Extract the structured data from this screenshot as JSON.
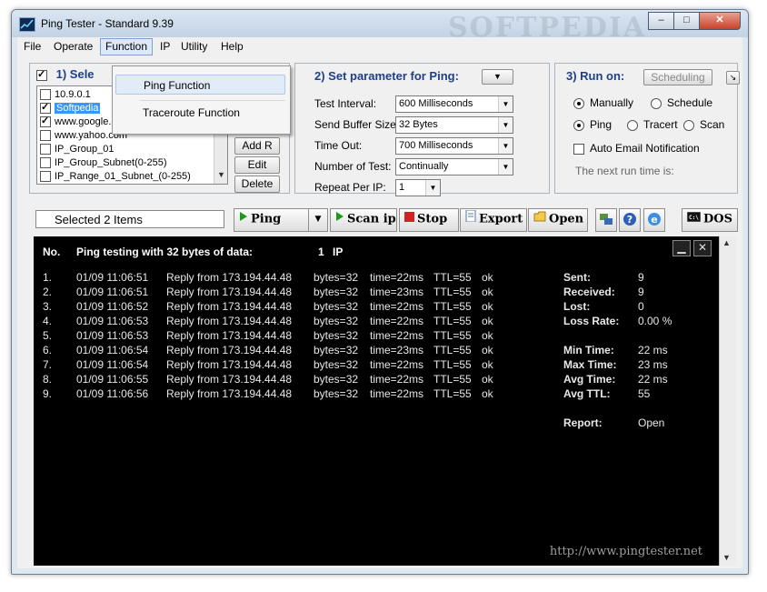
{
  "window": {
    "title": "Ping Tester - Standard  9.39",
    "buttons": [
      "–",
      "□",
      "✕"
    ],
    "watermark": "SOFTPEDIA"
  },
  "menubar": {
    "items": [
      "File",
      "Operate",
      "Function",
      "IP",
      "Utility",
      "Help"
    ],
    "active": "Function"
  },
  "function_menu": {
    "items": [
      "Ping Function",
      "Traceroute Function"
    ]
  },
  "select_ip": {
    "heading": "1) Sele",
    "items": [
      {
        "label": "10.9.0.1",
        "checked": false,
        "selected": false
      },
      {
        "label": "Softpedia",
        "checked": true,
        "selected": true
      },
      {
        "label": "www.google.com",
        "checked": true,
        "selected": false
      },
      {
        "label": "www.yahoo.com",
        "checked": false,
        "selected": false
      },
      {
        "label": "IP_Group_01",
        "checked": false,
        "selected": false
      },
      {
        "label": "IP_Group_Subnet(0-255)",
        "checked": false,
        "selected": false
      },
      {
        "label": "IP_Range_01_Subnet_(0-255)",
        "checked": false,
        "selected": false
      }
    ],
    "buttons": {
      "add": "Add R",
      "edit": "Edit",
      "delete": "Delete"
    }
  },
  "params": {
    "heading": "2) Set parameter for Ping:",
    "fields": [
      {
        "label": "Test Interval:",
        "value": "600  Milliseconds"
      },
      {
        "label": "Send Buffer Size:",
        "value": "32  Bytes"
      },
      {
        "label": "Time Out:",
        "value": "700  Milliseconds"
      },
      {
        "label": "Number of Test:",
        "value": "Continually"
      },
      {
        "label": "Repeat Per IP:",
        "value": "1"
      }
    ]
  },
  "run_on": {
    "heading": "3) Run on:",
    "scheduling_button": "Scheduling",
    "manually": "Manually",
    "schedule": "Schedule",
    "ping": "Ping",
    "tracert": "Tracert",
    "scan": "Scan",
    "auto_email": "Auto Email Notification",
    "next_run": "The next run time is:"
  },
  "toolbar": {
    "status": "Selected 2 Items",
    "ping": "Ping",
    "scan_ip": "Scan ip",
    "stop": "Stop",
    "export": "Export",
    "open": "Open",
    "dos": "DOS"
  },
  "console": {
    "header_no": "No.",
    "header_text": "Ping testing with 32 bytes of data:",
    "header_count": "1",
    "header_ip": "IP",
    "rows": [
      {
        "no": "1.",
        "time": "01/09 11:06:51",
        "reply": "Reply from 173.194.44.48",
        "bytes": "bytes=32",
        "rtt": "time=22ms",
        "ttl": "TTL=55",
        "status": "ok"
      },
      {
        "no": "2.",
        "time": "01/09 11:06:51",
        "reply": "Reply from 173.194.44.48",
        "bytes": "bytes=32",
        "rtt": "time=23ms",
        "ttl": "TTL=55",
        "status": "ok"
      },
      {
        "no": "3.",
        "time": "01/09 11:06:52",
        "reply": "Reply from 173.194.44.48",
        "bytes": "bytes=32",
        "rtt": "time=22ms",
        "ttl": "TTL=55",
        "status": "ok"
      },
      {
        "no": "4.",
        "time": "01/09 11:06:53",
        "reply": "Reply from 173.194.44.48",
        "bytes": "bytes=32",
        "rtt": "time=22ms",
        "ttl": "TTL=55",
        "status": "ok"
      },
      {
        "no": "5.",
        "time": "01/09 11:06:53",
        "reply": "Reply from 173.194.44.48",
        "bytes": "bytes=32",
        "rtt": "time=22ms",
        "ttl": "TTL=55",
        "status": "ok"
      },
      {
        "no": "6.",
        "time": "01/09 11:06:54",
        "reply": "Reply from 173.194.44.48",
        "bytes": "bytes=32",
        "rtt": "time=23ms",
        "ttl": "TTL=55",
        "status": "ok"
      },
      {
        "no": "7.",
        "time": "01/09 11:06:54",
        "reply": "Reply from 173.194.44.48",
        "bytes": "bytes=32",
        "rtt": "time=22ms",
        "ttl": "TTL=55",
        "status": "ok"
      },
      {
        "no": "8.",
        "time": "01/09 11:06:55",
        "reply": "Reply from 173.194.44.48",
        "bytes": "bytes=32",
        "rtt": "time=22ms",
        "ttl": "TTL=55",
        "status": "ok"
      },
      {
        "no": "9.",
        "time": "01/09 11:06:56",
        "reply": "Reply from 173.194.44.48",
        "bytes": "bytes=32",
        "rtt": "time=22ms",
        "ttl": "TTL=55",
        "status": "ok"
      }
    ],
    "stats": [
      {
        "label": "Sent:",
        "value": "9"
      },
      {
        "label": "Received:",
        "value": "9"
      },
      {
        "label": "Lost:",
        "value": "0"
      },
      {
        "label": "Loss Rate:",
        "value": "0.00 %"
      },
      {
        "label": "Min Time:",
        "value": "22 ms"
      },
      {
        "label": "Max Time:",
        "value": "23 ms"
      },
      {
        "label": "Avg Time:",
        "value": "22 ms"
      },
      {
        "label": "Avg TTL:",
        "value": "55"
      },
      {
        "label": "Report:",
        "value": "Open"
      }
    ],
    "url": "http://www.pingtester.net"
  },
  "colors": {
    "heading": "#1e3f8a",
    "console_bg": "#000000",
    "selection": "#3399ff"
  }
}
